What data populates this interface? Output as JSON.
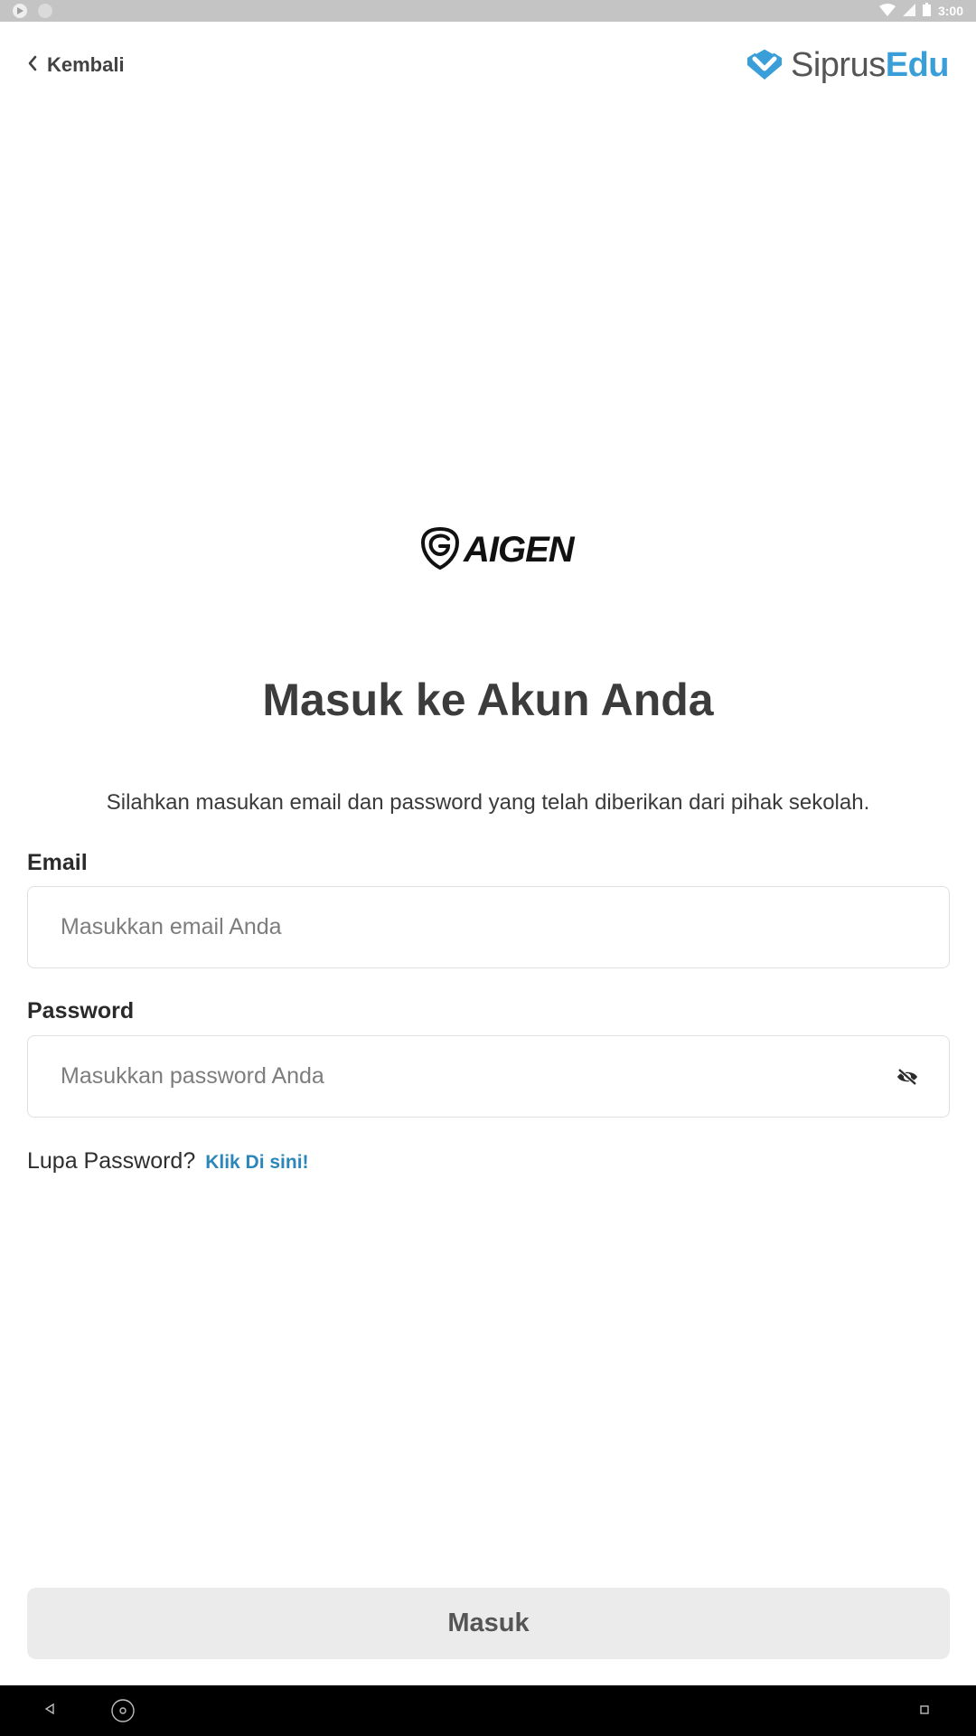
{
  "status_bar": {
    "time": "3:00",
    "icons": [
      "play-store-icon",
      "notification-dot-icon",
      "wifi-icon",
      "signal-icon",
      "battery-icon"
    ]
  },
  "header": {
    "back_label": "Kembali",
    "brand_part1": "Siprus",
    "brand_part2": "Edu",
    "brand_color": "#3a9fd9"
  },
  "logo": {
    "text": "AIGEN"
  },
  "login": {
    "title": "Masuk ke Akun Anda",
    "subtitle": "Silahkan masukan email dan password yang telah diberikan dari pihak sekolah.",
    "email_label": "Email",
    "email_placeholder": "Masukkan email Anda",
    "email_value": "",
    "password_label": "Password",
    "password_placeholder": "Masukkan password Anda",
    "password_value": "",
    "forgot_text": "Lupa Password?",
    "forgot_link": "Klik Di sini!",
    "submit_label": "Masuk"
  },
  "nav": {
    "buttons": [
      "back-nav-icon",
      "home-nav-icon",
      "recents-nav-icon"
    ]
  }
}
